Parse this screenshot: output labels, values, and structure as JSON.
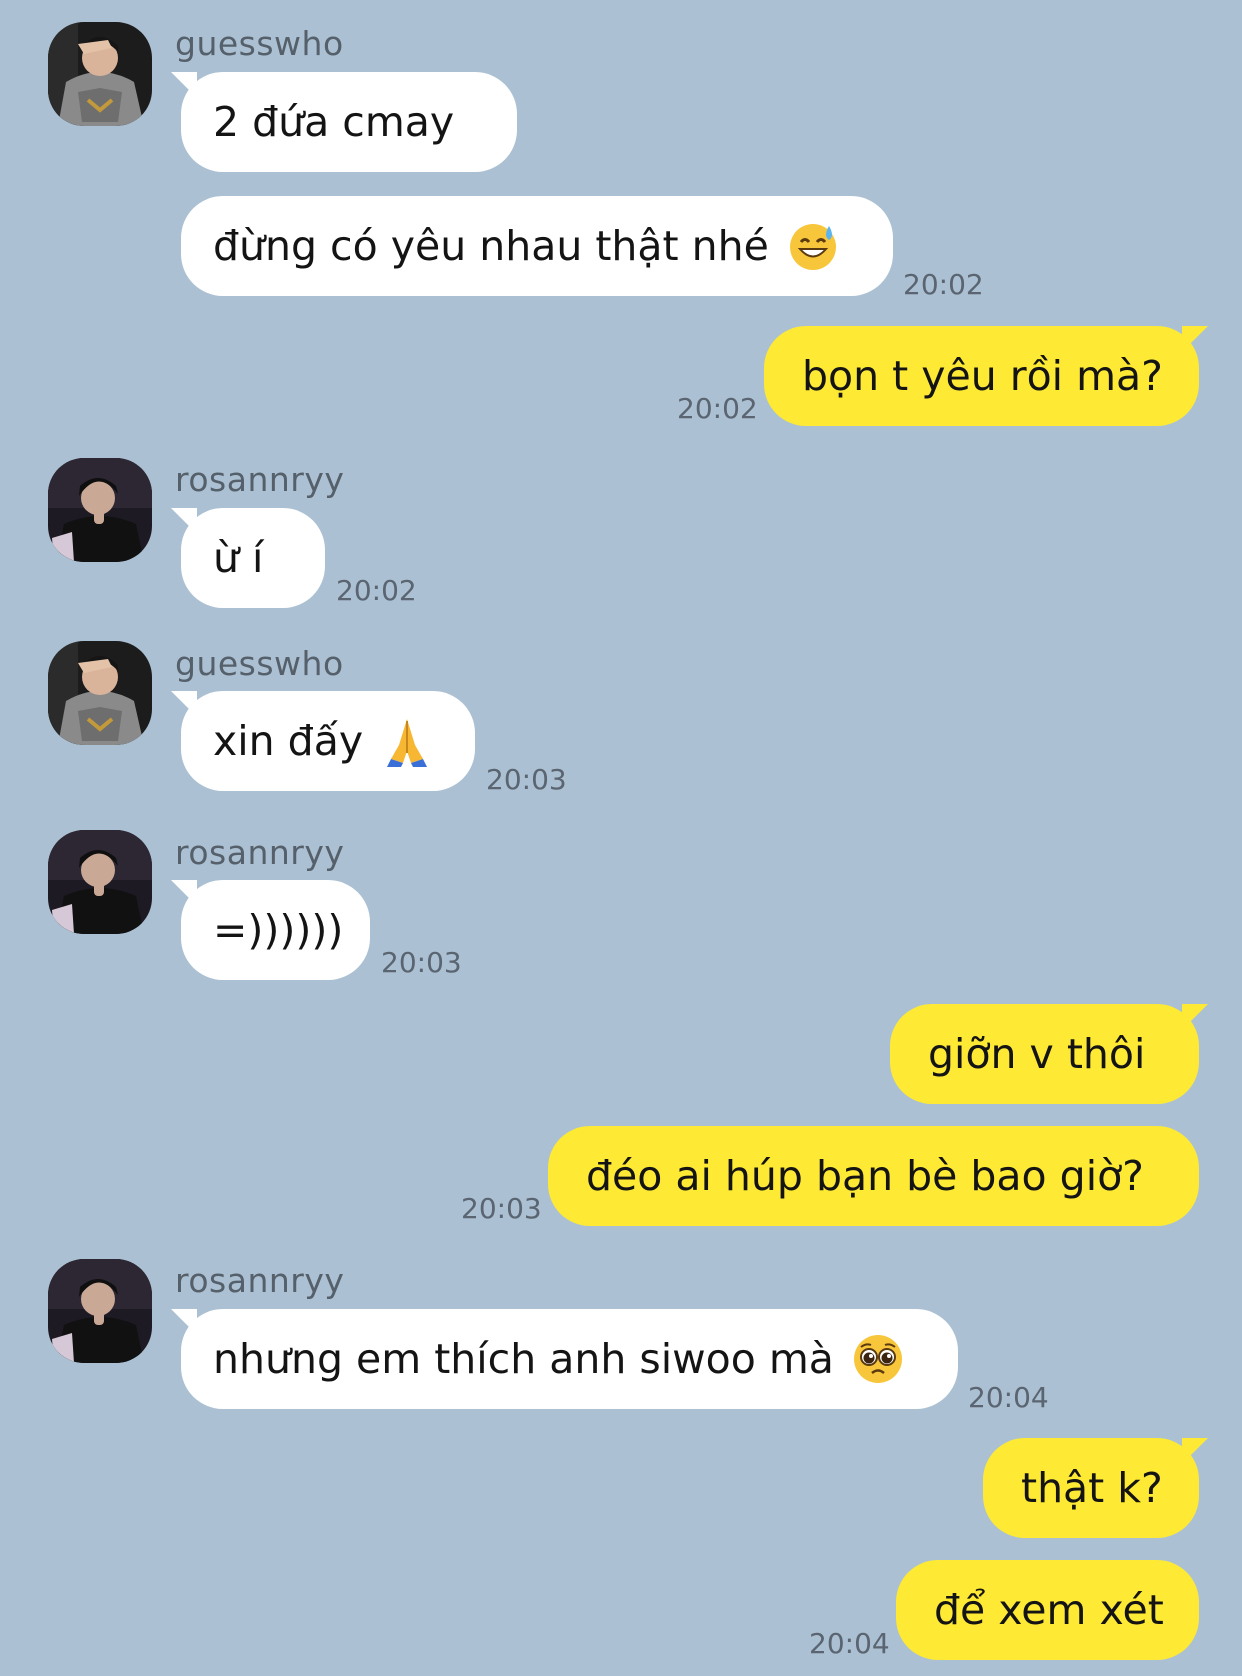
{
  "colors": {
    "background": "#abc1d3",
    "incoming_bubble": "#ffffff",
    "outgoing_bubble": "#fee934",
    "timestamp": "#5b6571"
  },
  "users": {
    "guesswho": "guesswho",
    "rosannryy": "rosannryy"
  },
  "messages": [
    {
      "text": "2 đứa cmay"
    },
    {
      "text": "đừng có yêu nhau thật nhé",
      "emoji": "sweat-smile-emoji",
      "time": "20:02"
    },
    {
      "text": "bọn t yêu rồi mà?",
      "time": "20:02"
    },
    {
      "text": "ừ í",
      "time": "20:02"
    },
    {
      "text": "xin đấy",
      "emoji": "folded-hands-emoji",
      "time": "20:03"
    },
    {
      "text": "=))))))",
      "time": "20:03"
    },
    {
      "text": "giỡn v thôi"
    },
    {
      "text": "đéo ai húp bạn bè bao giờ?",
      "time": "20:03"
    },
    {
      "text": "nhưng em thích anh siwoo mà",
      "emoji": "pleading-face-emoji",
      "time": "20:04"
    },
    {
      "text": "thật k?"
    },
    {
      "text": "để xem xét",
      "time": "20:04"
    }
  ]
}
